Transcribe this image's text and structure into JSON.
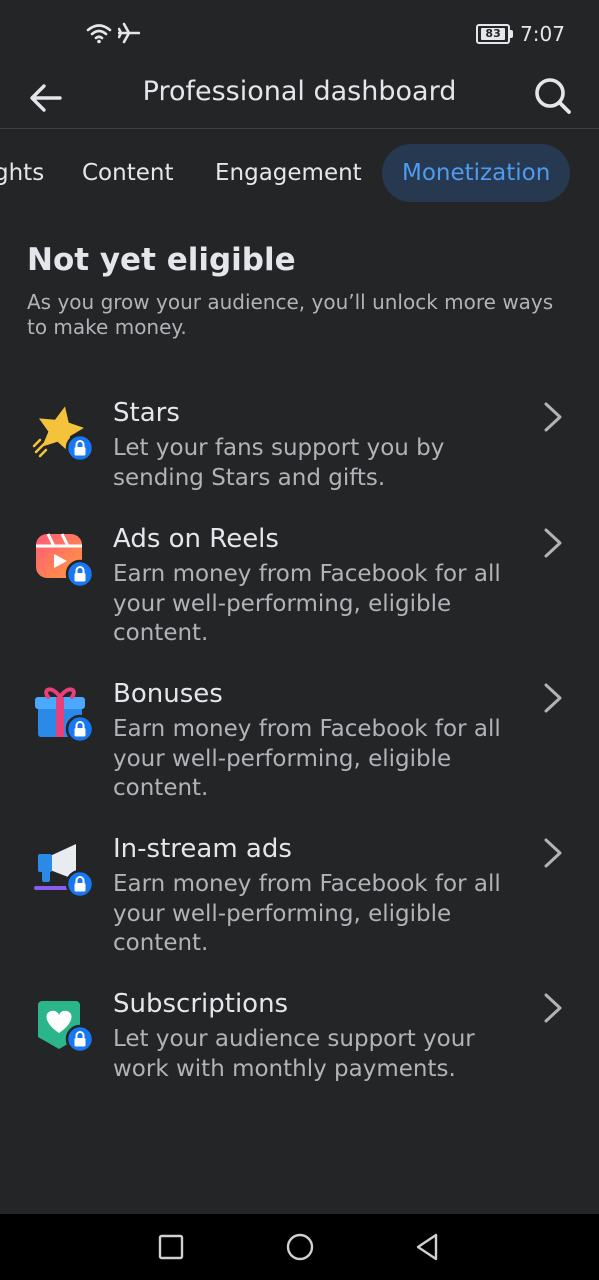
{
  "status_bar": {
    "battery": "83",
    "time": "7:07",
    "icons": [
      "wifi-icon",
      "airplane-icon"
    ]
  },
  "header": {
    "title": "Professional dashboard",
    "back_icon": "arrow-left-icon",
    "search_icon": "search-icon"
  },
  "tabs": [
    {
      "label": "ghts"
    },
    {
      "label": "Content"
    },
    {
      "label": "Engagement"
    },
    {
      "label": "Monetization",
      "active": true
    }
  ],
  "main": {
    "title": "Not yet eligible",
    "subtitle": "As you grow your audience, you’ll unlock more ways to make money."
  },
  "items": [
    {
      "name": "Stars",
      "description": "Let your fans support you by sending Stars and gifts.",
      "icon": "star-icon"
    },
    {
      "name": "Ads on Reels",
      "description": "Earn money from Facebook for all your well-performing, eligible content.",
      "icon": "reels-icon"
    },
    {
      "name": "Bonuses",
      "description": "Earn money from Facebook for all your well-performing, eligible content.",
      "icon": "gift-icon"
    },
    {
      "name": "In-stream ads",
      "description": "Earn money from Facebook for all your well-performing, eligible content.",
      "icon": "megaphone-icon"
    },
    {
      "name": "Subscriptions",
      "description": "Let your audience support your work with monthly payments.",
      "icon": "heart-badge-icon"
    }
  ],
  "colors": {
    "background": "#242526",
    "accent": "#4f9bf0",
    "active_tab_bg": "#263951",
    "lock_badge": "#1877f2"
  },
  "nav_bar": {
    "icons": [
      "recents-square-icon",
      "home-circle-icon",
      "back-triangle-icon"
    ]
  }
}
